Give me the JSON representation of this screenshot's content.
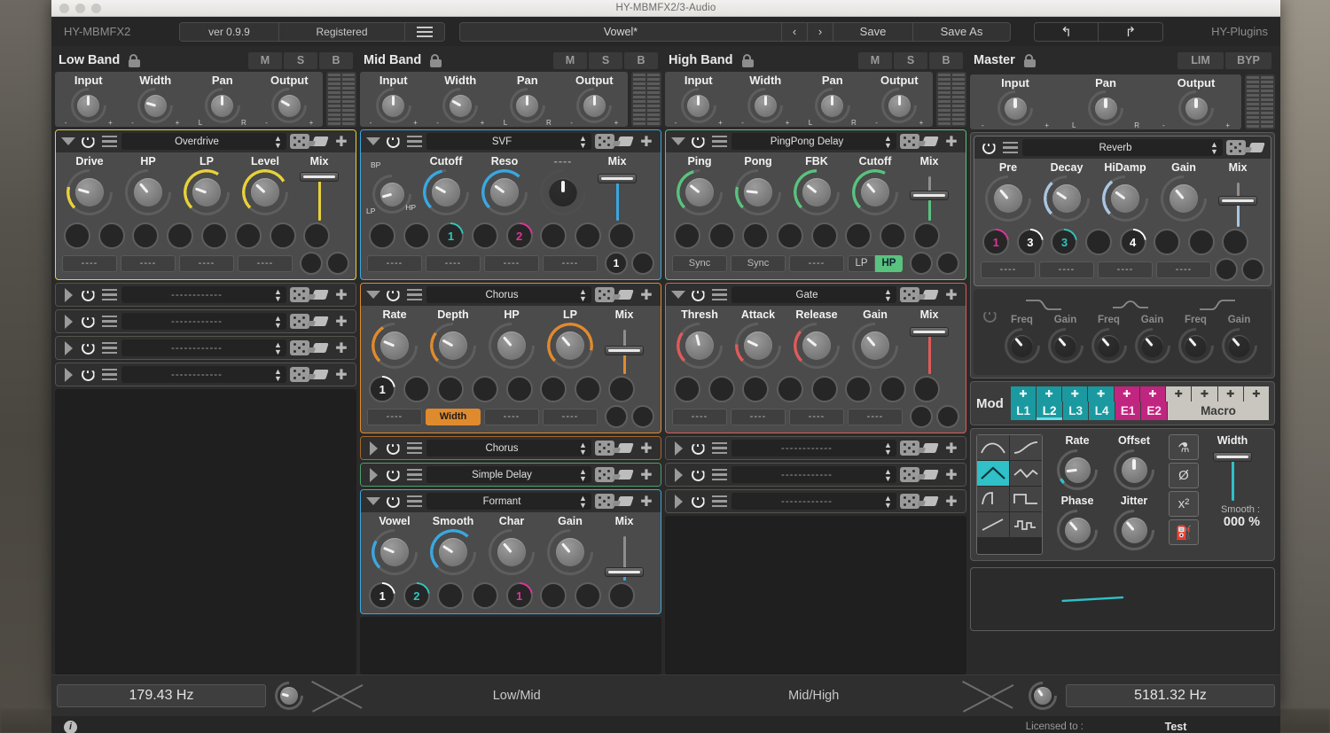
{
  "window": {
    "title": "HY-MBMFX2/3-Audio"
  },
  "topbar": {
    "brand": "HY-MBMFX2",
    "version": "ver 0.9.9",
    "registered": "Registered",
    "menu_icon": "hamburger-icon",
    "preset_name": "Vowel*",
    "prev": "‹",
    "next": "›",
    "save": "Save",
    "save_as": "Save As",
    "undo_icon": "undo-icon",
    "redo_icon": "redo-icon",
    "vendor": "HY-Plugins"
  },
  "bands": [
    {
      "title": "Low Band",
      "lock_icon": "unlock-icon",
      "buttons": [
        "M",
        "S",
        "B"
      ],
      "io": [
        {
          "label": "Input",
          "left": "-",
          "right": "+",
          "value": 0.0
        },
        {
          "label": "Width",
          "left": "-",
          "right": "+",
          "value": -0.55
        },
        {
          "label": "Pan",
          "left": "L",
          "right": "R",
          "value": 0.0
        },
        {
          "label": "Output",
          "left": "-",
          "right": "+",
          "value": -0.45
        }
      ],
      "slots": [
        {
          "expanded": true,
          "name": "Overdrive",
          "power": true,
          "accent": "#e8d13a",
          "knobs": [
            {
              "label": "Drive",
              "value": -0.55,
              "arc": 0.22
            },
            {
              "label": "HP",
              "value": -0.3,
              "arc": 0.0
            },
            {
              "label": "LP",
              "value": -0.52,
              "arc": 0.62
            },
            {
              "label": "Level",
              "value": -0.35,
              "arc": 0.72
            }
          ],
          "mix": {
            "label": "Mix",
            "value": 1.0
          },
          "mods": [
            "",
            "",
            "",
            "",
            "",
            "",
            "",
            ""
          ],
          "buttons": [
            "----",
            "----",
            "----",
            "----"
          ],
          "end_knobs": [
            "",
            ""
          ]
        },
        {
          "expanded": false,
          "name": "------------",
          "power": true,
          "accent": ""
        },
        {
          "expanded": false,
          "name": "------------",
          "power": true,
          "accent": ""
        },
        {
          "expanded": false,
          "name": "------------",
          "power": true,
          "accent": ""
        },
        {
          "expanded": false,
          "name": "------------",
          "power": true,
          "accent": ""
        }
      ]
    },
    {
      "title": "Mid Band",
      "lock_icon": "unlock-icon",
      "buttons": [
        "M",
        "S",
        "B"
      ],
      "io": [
        {
          "label": "Input",
          "left": "-",
          "right": "+",
          "value": 0.0
        },
        {
          "label": "Width",
          "left": "-",
          "right": "+",
          "value": -0.45
        },
        {
          "label": "Pan",
          "left": "L",
          "right": "R",
          "value": 0.0
        },
        {
          "label": "Output",
          "left": "-",
          "right": "+",
          "value": 0.0
        }
      ],
      "slots": [
        {
          "expanded": true,
          "name": "SVF",
          "power": true,
          "accent": "#3aa7e0",
          "mode_knob": {
            "top": "BP",
            "left": "LP",
            "right": "HP",
            "value": -0.78
          },
          "knobs": [
            {
              "label": "Cutoff",
              "value": -0.45,
              "arc": 0.46
            },
            {
              "label": "Reso",
              "value": -0.4,
              "arc": 0.66
            },
            {
              "label": "----",
              "value": null,
              "arc": 0.0,
              "dark": true
            }
          ],
          "mix": {
            "label": "Mix",
            "value": 0.95
          },
          "mods": [
            "",
            "",
            "1",
            "",
            "2",
            "",
            "",
            ""
          ],
          "mod_colors": [
            "",
            "",
            "#2ec6bc",
            "",
            "#e0329b",
            "",
            "",
            ""
          ],
          "buttons": [
            "----",
            "----",
            "----",
            "----"
          ],
          "end_knobs": [
            "1",
            ""
          ]
        },
        {
          "expanded": true,
          "name": "Chorus",
          "power": true,
          "accent": "#e08a2e",
          "knobs": [
            {
              "label": "Rate",
              "value": -0.5,
              "arc": 0.38
            },
            {
              "label": "Depth",
              "value": -0.45,
              "arc": 0.3
            },
            {
              "label": "HP",
              "value": -0.3,
              "arc": 0.0
            },
            {
              "label": "LP",
              "value": -0.3,
              "arc": 0.88
            }
          ],
          "mix": {
            "label": "Mix",
            "value": 0.48
          },
          "mods": [
            "1",
            "",
            "",
            "",
            "",
            "",
            "",
            ""
          ],
          "mod_colors": [
            "#ffffff",
            "",
            "",
            "",
            "",
            "",
            "",
            ""
          ],
          "buttons": [
            "----",
            "Width",
            "----",
            "----"
          ],
          "button_highlight": 1,
          "end_knobs": [
            "",
            ""
          ]
        },
        {
          "expanded": false,
          "name": "Chorus",
          "power": true,
          "accent": "#a8692a"
        },
        {
          "expanded": false,
          "name": "Simple Delay",
          "power": true,
          "accent": "#4f9e6e"
        },
        {
          "expanded": true,
          "name": "Formant",
          "power": true,
          "accent": "#3aa7e0",
          "knobs": [
            {
              "label": "Vowel",
              "value": -0.5,
              "arc": 0.28
            },
            {
              "label": "Smooth",
              "value": -0.42,
              "arc": 0.66
            },
            {
              "label": "Char",
              "value": -0.3,
              "arc": 0.0
            },
            {
              "label": "Gain",
              "value": -0.3,
              "arc": 0.0
            }
          ],
          "mix": {
            "label": "Mix",
            "value": 0.1
          },
          "mods": [
            "1",
            "2",
            "",
            "",
            "1",
            "",
            "",
            ""
          ],
          "mod_colors": [
            "#ffffff",
            "#2ec6bc",
            "",
            "",
            "#e0329b",
            "",
            "",
            ""
          ]
        }
      ]
    },
    {
      "title": "High Band",
      "lock_icon": "unlock-icon",
      "buttons": [
        "M",
        "S",
        "B"
      ],
      "io": [
        {
          "label": "Input",
          "left": "-",
          "right": "+",
          "value": 0.0
        },
        {
          "label": "Width",
          "left": "-",
          "right": "+",
          "value": 0.0
        },
        {
          "label": "Pan",
          "left": "L",
          "right": "R",
          "value": 0.0
        },
        {
          "label": "Output",
          "left": "-",
          "right": "+",
          "value": 0.0
        }
      ],
      "slots": [
        {
          "expanded": true,
          "name": "PingPong Delay",
          "power": true,
          "accent": "#59c27e",
          "knobs": [
            {
              "label": "Ping",
              "value": -0.38,
              "arc": 0.44
            },
            {
              "label": "Pong",
              "value": -0.62,
              "arc": 0.22
            },
            {
              "label": "FBK",
              "value": -0.38,
              "arc": 0.5
            },
            {
              "label": "Cutoff",
              "value": -0.3,
              "arc": 0.6
            }
          ],
          "mix": {
            "label": "Mix",
            "value": 0.52
          },
          "mods": [
            "",
            "",
            "",
            "",
            "",
            "",
            "",
            ""
          ],
          "buttons": [
            "Sync",
            "Sync",
            "----"
          ],
          "toggle": {
            "options": [
              "LP",
              "HP"
            ],
            "selected": "HP"
          },
          "end_knobs": [
            "",
            ""
          ]
        },
        {
          "expanded": true,
          "name": "Gate",
          "power": true,
          "accent": "#e05a5a",
          "knobs": [
            {
              "label": "Thresh",
              "value": -0.1,
              "arc": 0.3
            },
            {
              "label": "Attack",
              "value": -0.48,
              "arc": 0.18
            },
            {
              "label": "Release",
              "value": -0.38,
              "arc": 0.32
            },
            {
              "label": "Gain",
              "value": -0.3,
              "arc": 0.0
            }
          ],
          "mix": {
            "label": "Mix",
            "value": 0.95
          },
          "mods": [
            "",
            "",
            "",
            "",
            "",
            "",
            "",
            ""
          ],
          "buttons": [
            "----",
            "----",
            "----",
            "----"
          ],
          "end_knobs": [
            "",
            ""
          ]
        },
        {
          "expanded": false,
          "name": "------------",
          "power": true,
          "accent": ""
        },
        {
          "expanded": false,
          "name": "------------",
          "power": true,
          "accent": ""
        },
        {
          "expanded": false,
          "name": "------------",
          "power": true,
          "accent": ""
        }
      ]
    }
  ],
  "master": {
    "title": "Master",
    "lock_icon": "unlock-icon",
    "buttons": [
      "LIM",
      "BYP"
    ],
    "io": [
      {
        "label": "Input",
        "left": "-",
        "right": "+",
        "value": 0.0
      },
      {
        "label": "Pan",
        "left": "L",
        "right": "R",
        "value": 0.0
      },
      {
        "label": "Output",
        "left": "-",
        "right": "+",
        "value": 0.0
      }
    ],
    "reverb": {
      "name": "Reverb",
      "power": true,
      "accent": "#a9c6e0",
      "knobs": [
        {
          "label": "Pre",
          "value": -0.3,
          "arc": 0.0
        },
        {
          "label": "Decay",
          "value": -0.42,
          "arc": 0.34
        },
        {
          "label": "HiDamp",
          "value": -0.4,
          "arc": 0.36
        },
        {
          "label": "Gain",
          "value": -0.3,
          "arc": 0.0
        }
      ],
      "mix": {
        "label": "Mix",
        "value": 0.55
      },
      "mods": [
        "1",
        "3",
        "3",
        "",
        "4",
        "",
        "",
        ""
      ],
      "mod_colors": [
        "#e0329b",
        "#ffffff",
        "#2ec6bc",
        "",
        "#ffffff",
        "",
        "",
        ""
      ],
      "buttons": [
        "----",
        "----",
        "----",
        "----"
      ],
      "end_knobs": [
        "",
        ""
      ]
    },
    "eq": {
      "power": false,
      "bands": [
        {
          "icon": "low-shelf-icon",
          "freq_label": "Freq",
          "gain_label": "Gain"
        },
        {
          "icon": "bell-icon",
          "freq_label": "Freq",
          "gain_label": "Gain"
        },
        {
          "icon": "high-shelf-icon",
          "freq_label": "Freq",
          "gain_label": "Gain"
        }
      ]
    },
    "mod": {
      "label": "Mod",
      "tabs": [
        "L1",
        "L2",
        "L3",
        "L4",
        "E1",
        "E2"
      ],
      "selected_tab": "L2",
      "macro_label": "Macro",
      "move_icon": "move-icon"
    },
    "lfo": {
      "waveforms": [
        "sine",
        "ramp-smooth",
        "triangle",
        "saw-soft",
        "exp",
        "square",
        "ramp",
        "random-steps"
      ],
      "selected_waveform_index": 2,
      "knobs": [
        {
          "label": "Rate",
          "value": -0.72,
          "arc": 0.06
        },
        {
          "label": "Offset",
          "value": 0.0,
          "arc": 0.0
        },
        {
          "label": "Phase",
          "value": -0.3,
          "arc": 0.0
        },
        {
          "label": "Jitter",
          "value": -0.3,
          "arc": 0.0
        }
      ],
      "buttons": [
        "metronome-icon",
        "phase-invert-icon",
        "power-curve-icon",
        "fuel-icon"
      ],
      "width_label": "Width",
      "width_value": 1.0,
      "smooth_label": "Smooth :",
      "smooth_value": "000 %"
    }
  },
  "crossover": {
    "low_mid_hz": "179.43 Hz",
    "mid_high_hz": "5181.32 Hz",
    "low_mid_label": "Low/Mid",
    "mid_high_label": "Mid/High"
  },
  "statusbar": {
    "info_icon": "info-icon",
    "license_label": "Licensed to :",
    "license_value": "Test"
  }
}
